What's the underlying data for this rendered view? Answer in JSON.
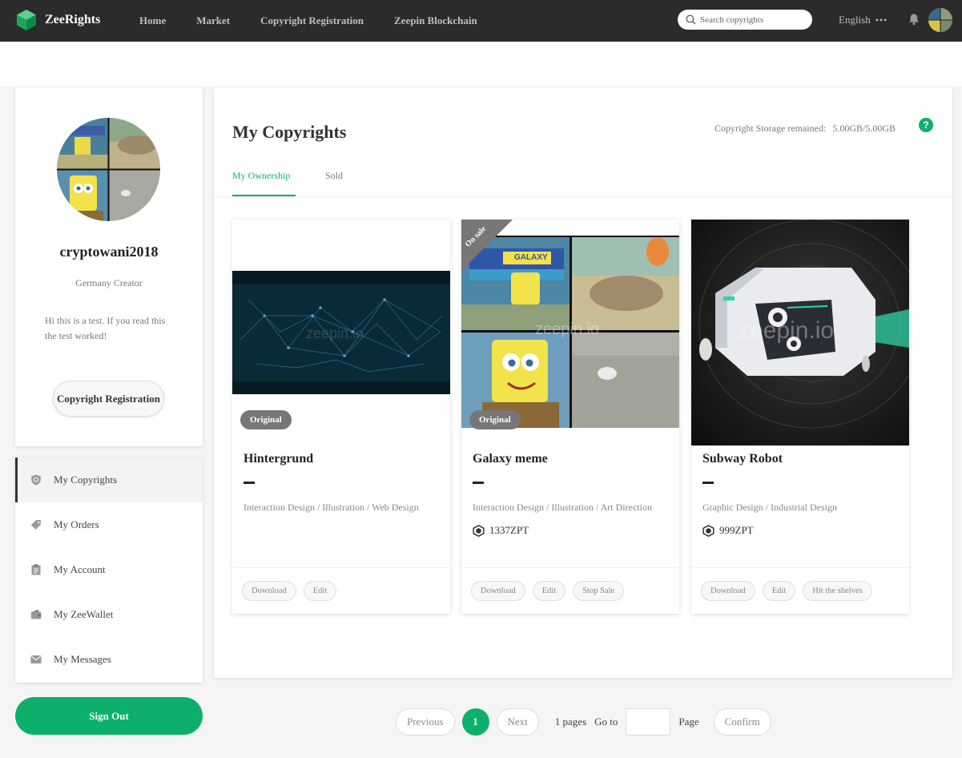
{
  "brand": {
    "name": "ZeeRights",
    "accent": "#0cb06b"
  },
  "nav": {
    "items": [
      "Home",
      "Market",
      "Copyright Registration",
      "Zeepin Blockchain"
    ]
  },
  "search": {
    "placeholder": "Search copyrights"
  },
  "language": {
    "label": "English",
    "more": "•••"
  },
  "profile": {
    "username": "cryptowani2018",
    "role": "Germany Creator",
    "bio": "Hi this is a test. If you read this the test worked!",
    "register_label": "Copyright Registration"
  },
  "menu": {
    "items": [
      {
        "label": "My Copyrights",
        "icon": "copyright-icon"
      },
      {
        "label": "My Orders",
        "icon": "tag-icon"
      },
      {
        "label": "My Account",
        "icon": "clipboard-icon"
      },
      {
        "label": "My ZeeWallet",
        "icon": "wallet-icon"
      },
      {
        "label": "My Messages",
        "icon": "mail-icon"
      }
    ],
    "active": "My Copyrights"
  },
  "signout_label": "Sign Out",
  "main": {
    "title": "My Copyrights",
    "storage_label": "Copyright Storage remained:",
    "storage_value": "5.00GB/5.00GB",
    "help": "?",
    "tabs": [
      "My Ownership",
      "Sold"
    ],
    "active_tab": "My Ownership"
  },
  "cards": [
    {
      "title": "Hintergrund",
      "badge": "Original",
      "tags": "Interaction Design / Illustration / Web Design",
      "price": "",
      "on_sale": false,
      "watermark": "zeepin.io",
      "actions": [
        "Download",
        "Edit"
      ]
    },
    {
      "title": "Galaxy meme",
      "badge": "Original",
      "tags": "Interaction Design / Illustration / Art Direction",
      "price": "1337ZPT",
      "on_sale": true,
      "on_sale_label": "On sale",
      "sign_text": "GALAXY",
      "watermark": "zeepin.io",
      "actions": [
        "Download",
        "Edit",
        "Stop Sale"
      ]
    },
    {
      "title": "Subway Robot",
      "badge": "",
      "tags": "Graphic Design / Industrial Design",
      "price": "999ZPT",
      "on_sale": false,
      "watermark": "zeepin.io",
      "actions": [
        "Download",
        "Edit",
        "Hit the shelves"
      ]
    }
  ],
  "pagination": {
    "previous": "Previous",
    "current": "1",
    "next": "Next",
    "pages_text": "1 pages",
    "goto_text": "Go to",
    "page_text": "Page",
    "confirm": "Confirm"
  }
}
